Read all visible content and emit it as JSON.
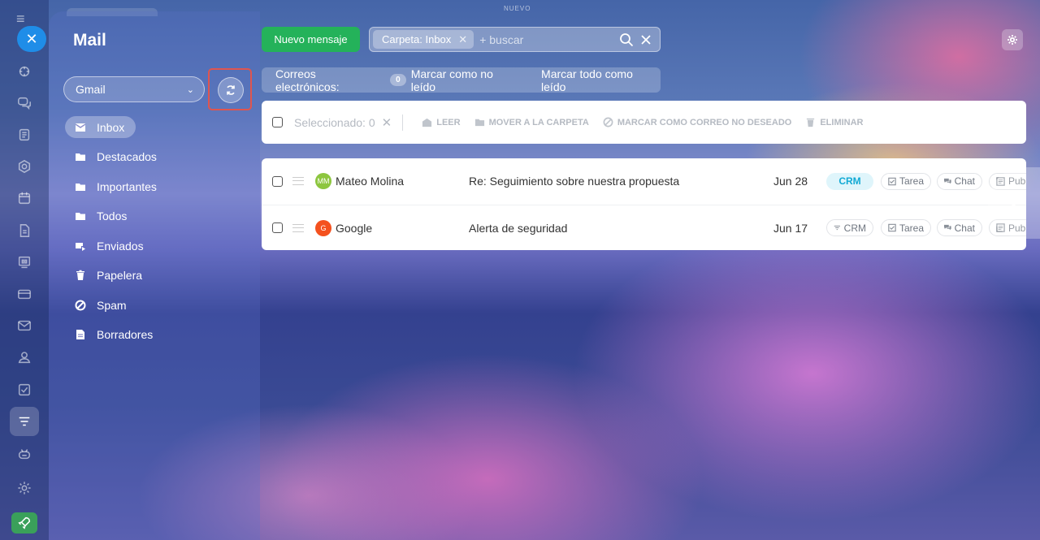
{
  "top_label": "NUEVO",
  "app": {
    "title": "Mail"
  },
  "account": {
    "selected": "Gmail"
  },
  "folders": [
    {
      "label": "Inbox",
      "icon": "mail-icon",
      "active": true
    },
    {
      "label": "Destacados",
      "icon": "folder-icon"
    },
    {
      "label": "Importantes",
      "icon": "folder-icon"
    },
    {
      "label": "Todos",
      "icon": "folder-icon"
    },
    {
      "label": "Enviados",
      "icon": "sent-icon"
    },
    {
      "label": "Papelera",
      "icon": "trash-icon"
    },
    {
      "label": "Spam",
      "icon": "spam-icon"
    },
    {
      "label": "Borradores",
      "icon": "draft-icon"
    }
  ],
  "header": {
    "new_message": "Nuevo mensaje",
    "filter_chip": "Carpeta: Inbox",
    "search_placeholder": "+ buscar"
  },
  "infobar": {
    "label": "Correos electrónicos:",
    "unread_count": "0",
    "mark_unread": "Marcar como no leído",
    "mark_all_read": "Marcar todo como leído"
  },
  "toolbar": {
    "selected": "Seleccionado: 0",
    "read": "LEER",
    "move": "MOVER A LA CARPETA",
    "spam": "MARCAR COMO CORREO NO DESEADO",
    "delete": "ELIMINAR"
  },
  "emails": [
    {
      "avatar": "MM",
      "avatar_color": "#8dc63f",
      "from": "Mateo Molina",
      "subject": "Re: Seguimiento sobre nuestra propuesta",
      "date": "Jun 28",
      "crm": "CRM",
      "crm_active": true,
      "task": "Tarea",
      "chat": "Chat",
      "pub": "Pub"
    },
    {
      "avatar": "G",
      "avatar_color": "#f4511e",
      "from": "Google",
      "subject": "Alerta de seguridad",
      "date": "Jun 17",
      "crm": "CRM",
      "crm_active": false,
      "task": "Tarea",
      "chat": "Chat",
      "pub": "Pub"
    }
  ],
  "colors": {
    "accent_blue": "#1f8de8",
    "new_message_green": "#24b25a",
    "highlight_red": "#e0554f",
    "crm_blue": "#11a9d4"
  }
}
